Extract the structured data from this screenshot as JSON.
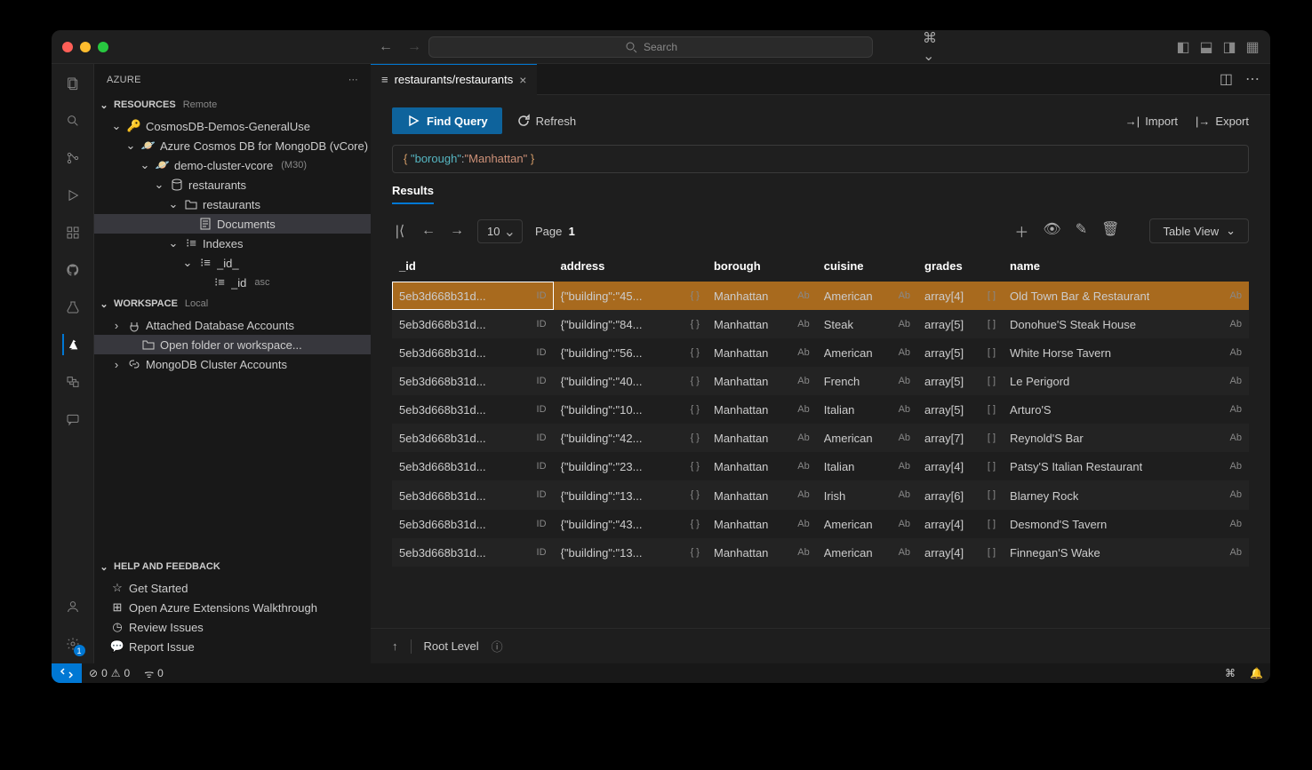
{
  "titlebar": {
    "search_placeholder": "Search"
  },
  "sidebar": {
    "title": "AZURE",
    "resources": {
      "label": "RESOURCES",
      "tag": "Remote"
    },
    "workspace": {
      "label": "WORKSPACE",
      "tag": "Local"
    },
    "help": {
      "label": "HELP AND FEEDBACK"
    },
    "tree": {
      "sub": "CosmosDB-Demos-GeneralUse",
      "svc": "Azure Cosmos DB for MongoDB (vCore)",
      "cluster": "demo-cluster-vcore",
      "cluster_tag": "(M30)",
      "db": "restaurants",
      "coll": "restaurants",
      "docs": "Documents",
      "indexes": "Indexes",
      "idx1": "_id_",
      "idx2": "_id",
      "idx2_tag": "asc"
    },
    "workspace_items": {
      "attached": "Attached Database Accounts",
      "open_folder": "Open folder or workspace...",
      "mongo": "MongoDB Cluster Accounts"
    },
    "help_items": {
      "started": "Get Started",
      "walk": "Open Azure Extensions Walkthrough",
      "review": "Review Issues",
      "report": "Report Issue"
    }
  },
  "tab": {
    "label": "restaurants/restaurants"
  },
  "toolbar": {
    "find": "Find Query",
    "refresh": "Refresh",
    "import": "Import",
    "export": "Export"
  },
  "query": {
    "key": "\"borough\"",
    "val": "\"Manhattan\""
  },
  "results_label": "Results",
  "pager": {
    "size": "10",
    "page_label": "Page",
    "page": "1",
    "view": "Table View"
  },
  "columns": [
    "_id",
    "address",
    "borough",
    "cuisine",
    "grades",
    "name"
  ],
  "rows": [
    {
      "id": "5eb3d668b31d...",
      "addr": "{\"building\":\"45...",
      "borough": "Manhattan",
      "cuisine": "American",
      "grades": "array[4]",
      "name": "Old Town Bar & Restaurant",
      "selected": true
    },
    {
      "id": "5eb3d668b31d...",
      "addr": "{\"building\":\"84...",
      "borough": "Manhattan",
      "cuisine": "Steak",
      "grades": "array[5]",
      "name": "Donohue'S Steak House"
    },
    {
      "id": "5eb3d668b31d...",
      "addr": "{\"building\":\"56...",
      "borough": "Manhattan",
      "cuisine": "American",
      "grades": "array[5]",
      "name": "White Horse Tavern"
    },
    {
      "id": "5eb3d668b31d...",
      "addr": "{\"building\":\"40...",
      "borough": "Manhattan",
      "cuisine": "French",
      "grades": "array[5]",
      "name": "Le Perigord"
    },
    {
      "id": "5eb3d668b31d...",
      "addr": "{\"building\":\"10...",
      "borough": "Manhattan",
      "cuisine": "Italian",
      "grades": "array[5]",
      "name": "Arturo'S"
    },
    {
      "id": "5eb3d668b31d...",
      "addr": "{\"building\":\"42...",
      "borough": "Manhattan",
      "cuisine": "American",
      "grades": "array[7]",
      "name": "Reynold'S Bar"
    },
    {
      "id": "5eb3d668b31d...",
      "addr": "{\"building\":\"23...",
      "borough": "Manhattan",
      "cuisine": "Italian",
      "grades": "array[4]",
      "name": "Patsy'S Italian Restaurant"
    },
    {
      "id": "5eb3d668b31d...",
      "addr": "{\"building\":\"13...",
      "borough": "Manhattan",
      "cuisine": "Irish",
      "grades": "array[6]",
      "name": "Blarney Rock"
    },
    {
      "id": "5eb3d668b31d...",
      "addr": "{\"building\":\"43...",
      "borough": "Manhattan",
      "cuisine": "American",
      "grades": "array[4]",
      "name": "Desmond'S Tavern"
    },
    {
      "id": "5eb3d668b31d...",
      "addr": "{\"building\":\"13...",
      "borough": "Manhattan",
      "cuisine": "American",
      "grades": "array[4]",
      "name": "Finnegan'S Wake"
    }
  ],
  "footer": {
    "root": "Root Level"
  },
  "statusbar": {
    "errors": "0",
    "warnings": "0",
    "ports": "0"
  }
}
